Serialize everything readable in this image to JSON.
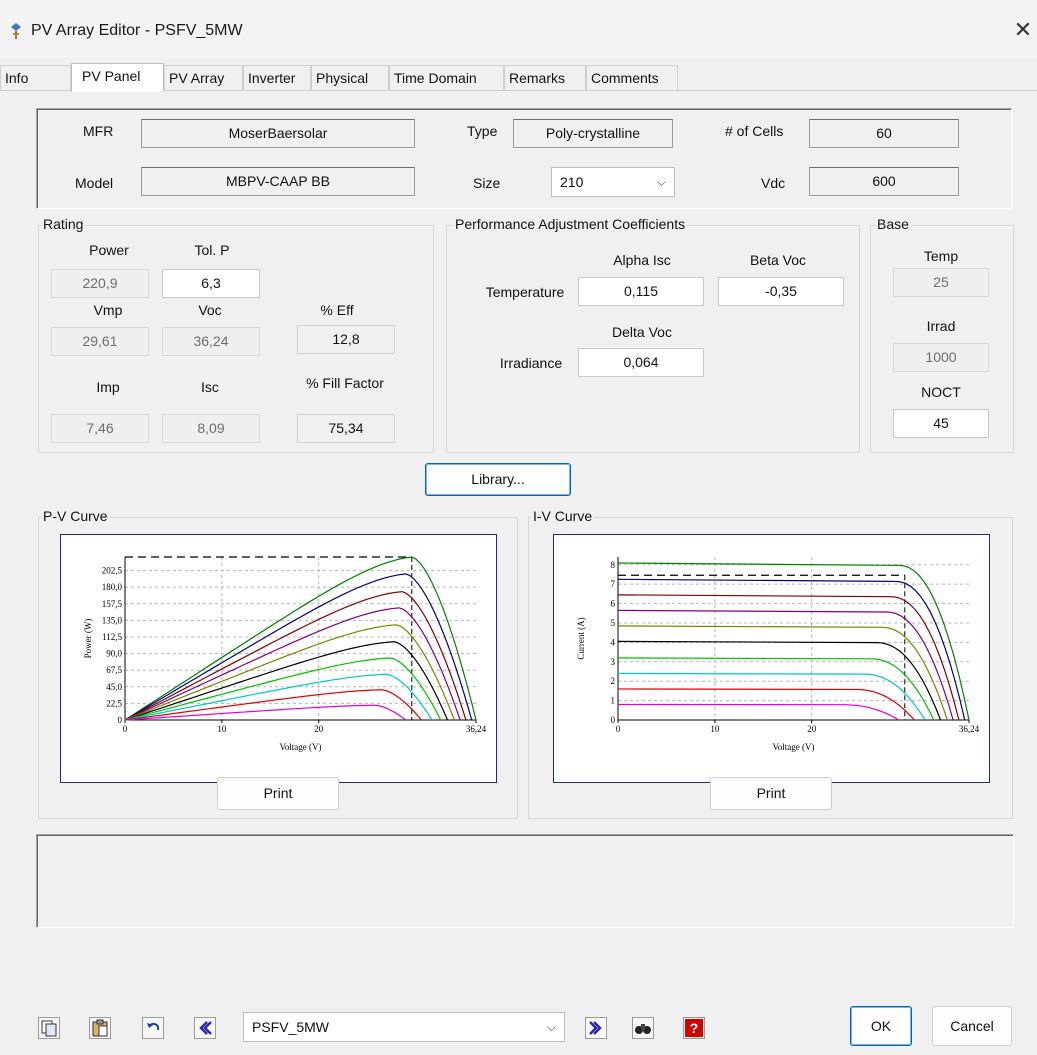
{
  "window": {
    "title": "PV Array Editor - PSFV_5MW",
    "close_icon": "close-icon"
  },
  "tabs": [
    "Info",
    "PV Panel",
    "PV Array",
    "Inverter",
    "Physical",
    "Time Domain",
    "Remarks",
    "Comments"
  ],
  "active_tab": "PV Panel",
  "panel": {
    "mfr_label": "MFR",
    "mfr_value": "MoserBaersolar",
    "type_label": "Type",
    "type_value": "Poly-crystalline",
    "cells_label": "# of Cells",
    "cells_value": "60",
    "model_label": "Model",
    "model_value": "MBPV-CAAP BB",
    "size_label": "Size",
    "size_value": "210",
    "vdc_label": "Vdc",
    "vdc_value": "600"
  },
  "rating": {
    "title": "Rating",
    "power_label": "Power",
    "power_value": "220,9",
    "tolp_label": "Tol. P",
    "tolp_value": "6,3",
    "vmp_label": "Vmp",
    "vmp_value": "29,61",
    "voc_label": "Voc",
    "voc_value": "36,24",
    "eff_label": "% Eff",
    "eff_value": "12,8",
    "imp_label": "Imp",
    "imp_value": "7,46",
    "isc_label": "Isc",
    "isc_value": "8,09",
    "ff_label": "% Fill Factor",
    "ff_value": "75,34"
  },
  "pac": {
    "title": "Performance Adjustment Coefficients",
    "alpha_label": "Alpha Isc",
    "beta_label": "Beta Voc",
    "temperature_label": "Temperature",
    "alpha_value": "0,115",
    "beta_value": "-0,35",
    "delta_label": "Delta Voc",
    "irradiance_label": "Irradiance",
    "delta_value": "0,064"
  },
  "base": {
    "title": "Base",
    "temp_label": "Temp",
    "temp_value": "25",
    "irrad_label": "Irrad",
    "irrad_value": "1000",
    "noct_label": "NOCT",
    "noct_value": "45"
  },
  "library_button": "Library...",
  "pv_curve": {
    "title": "P-V Curve",
    "print": "Print"
  },
  "iv_curve": {
    "title": "I-V Curve",
    "print": "Print"
  },
  "bottom": {
    "record_value": "PSFV_5MW",
    "ok": "OK",
    "cancel": "Cancel"
  },
  "chart_data": [
    {
      "type": "line",
      "xlabel": "Voltage (V)",
      "ylabel": "Power (W)",
      "xlim": [
        0,
        36.24
      ],
      "ylim": [
        0,
        220.9
      ],
      "x_ticks": [
        "0",
        "10",
        "20",
        "36,24"
      ],
      "y_ticks": [
        "0",
        "22,5",
        "45,0",
        "67,5",
        "90,0",
        "112,5",
        "135,0",
        "157,5",
        "180,0",
        "202,5"
      ],
      "mpp_voltage": 29.61,
      "max_power": 220.9,
      "series": [
        {
          "color": "#008000",
          "values": [
            {
              "vmp": 29.61,
              "pmax": 220.9
            },
            {
              "voc": 36.24
            }
          ]
        },
        {
          "color": "#000080",
          "values": [
            {
              "vmp": 29.0,
              "pmax": 198.0
            },
            {
              "voc": 35.8
            }
          ]
        },
        {
          "color": "#800000",
          "values": [
            {
              "vmp": 28.6,
              "pmax": 174.0
            },
            {
              "voc": 35.2
            }
          ]
        },
        {
          "color": "#800080",
          "values": [
            {
              "vmp": 28.3,
              "pmax": 152.0
            },
            {
              "voc": 34.6
            }
          ]
        },
        {
          "color": "#808000",
          "values": [
            {
              "vmp": 28.0,
              "pmax": 129.0
            },
            {
              "voc": 34.0
            }
          ]
        },
        {
          "color": "#000000",
          "values": [
            {
              "vmp": 27.8,
              "pmax": 106.0
            },
            {
              "voc": 33.3
            }
          ]
        },
        {
          "color": "#00c000",
          "values": [
            {
              "vmp": 27.4,
              "pmax": 84.0
            },
            {
              "voc": 32.6
            }
          ]
        },
        {
          "color": "#00c8c8",
          "values": [
            {
              "vmp": 27.0,
              "pmax": 62.0
            },
            {
              "voc": 31.7
            }
          ]
        },
        {
          "color": "#e00000",
          "values": [
            {
              "vmp": 26.5,
              "pmax": 41.0
            },
            {
              "voc": 30.6
            }
          ]
        },
        {
          "color": "#e000e0",
          "values": [
            {
              "vmp": 25.8,
              "pmax": 20.0
            },
            {
              "voc": 29.0
            }
          ]
        }
      ]
    },
    {
      "type": "line",
      "xlabel": "Voltage (V)",
      "ylabel": "Current (A)",
      "xlim": [
        0,
        36.24
      ],
      "ylim": [
        0,
        8.4
      ],
      "x_ticks": [
        "0",
        "10",
        "20",
        "36,24"
      ],
      "y_ticks": [
        "0",
        "1",
        "2",
        "3",
        "4",
        "5",
        "6",
        "7",
        "8"
      ],
      "mpp_voltage": 29.61,
      "imp": 7.46,
      "series": [
        {
          "color": "#008000",
          "isc": 8.09,
          "voc": 36.24
        },
        {
          "color": "#000080",
          "isc": 7.25,
          "voc": 35.8
        },
        {
          "color": "#800000",
          "isc": 6.45,
          "voc": 35.2
        },
        {
          "color": "#800080",
          "isc": 5.65,
          "voc": 34.6
        },
        {
          "color": "#808000",
          "isc": 4.85,
          "voc": 34.0
        },
        {
          "color": "#000000",
          "isc": 4.05,
          "voc": 33.3
        },
        {
          "color": "#00c000",
          "isc": 3.2,
          "voc": 32.6
        },
        {
          "color": "#00c8c8",
          "isc": 2.4,
          "voc": 31.7
        },
        {
          "color": "#e00000",
          "isc": 1.6,
          "voc": 30.6
        },
        {
          "color": "#e000e0",
          "isc": 0.8,
          "voc": 29.0
        }
      ]
    }
  ]
}
